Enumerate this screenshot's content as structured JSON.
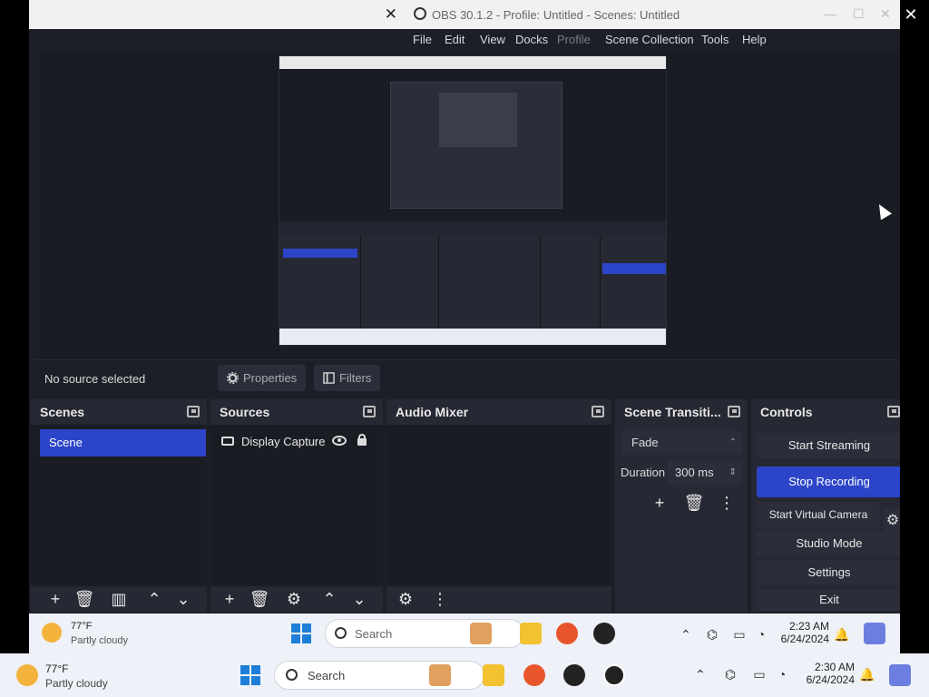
{
  "window": {
    "title": "OBS 30.1.2 - Profile: Untitled - Scenes: Untitled",
    "close": "✕"
  },
  "menu": {
    "items": [
      "File",
      "Edit",
      "View",
      "Docks",
      "Profile",
      "Scene Collection",
      "Tools",
      "Help"
    ]
  },
  "status": {
    "no_source": "No source selected",
    "properties": "Properties",
    "filters": "Filters"
  },
  "docks": {
    "scenes": {
      "title": "Scenes",
      "items": [
        "Scene"
      ]
    },
    "sources": {
      "title": "Sources",
      "items": [
        {
          "label": "Display Capture"
        }
      ]
    },
    "audio": {
      "title": "Audio Mixer"
    },
    "transitions": {
      "title": "Scene Transiti...",
      "selected": "Fade",
      "duration_label": "Duration",
      "duration_value": "300 ms"
    },
    "controls": {
      "title": "Controls",
      "buttons": [
        "Start Streaming",
        "Stop Recording",
        "Start Virtual Camera",
        "Studio Mode",
        "Settings",
        "Exit"
      ]
    }
  },
  "inner_taskbar": {
    "temp": "77°F",
    "weather": "Partly cloudy",
    "search": "Search",
    "time": "2:23 AM",
    "date": "6/24/2024"
  },
  "outer_taskbar": {
    "temp": "77°F",
    "weather": "Partly cloudy",
    "search": "Search",
    "time": "2:30 AM",
    "date": "6/24/2024"
  },
  "colors": {
    "accent": "#2c45c8",
    "dock_bg": "#262833",
    "panel_bg": "#1a1c24"
  }
}
